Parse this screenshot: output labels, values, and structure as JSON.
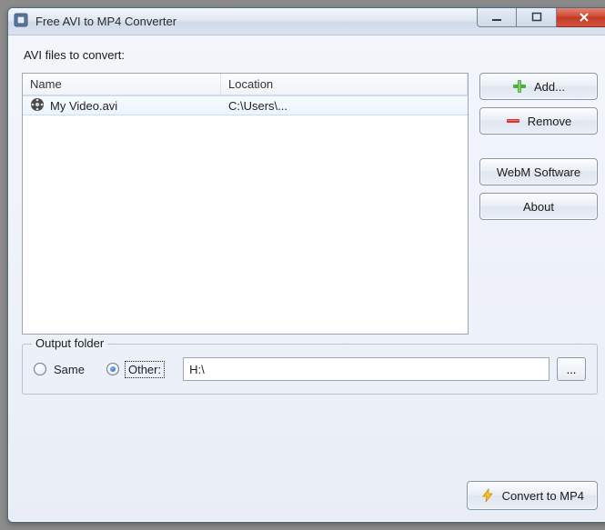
{
  "window": {
    "title": "Free AVI to MP4 Converter"
  },
  "section": {
    "files_label": "AVI files to convert:"
  },
  "list": {
    "columns": {
      "name": "Name",
      "location": "Location"
    },
    "row0": {
      "name": "My Video.avi",
      "location": "C:\\Users\\..."
    }
  },
  "buttons": {
    "add": "Add...",
    "remove": "Remove",
    "webm": "WebM Software",
    "about": "About",
    "browse": "...",
    "convert": "Convert to MP4"
  },
  "output": {
    "legend": "Output folder",
    "same": "Same",
    "other": "Other:",
    "path": "H:\\"
  }
}
